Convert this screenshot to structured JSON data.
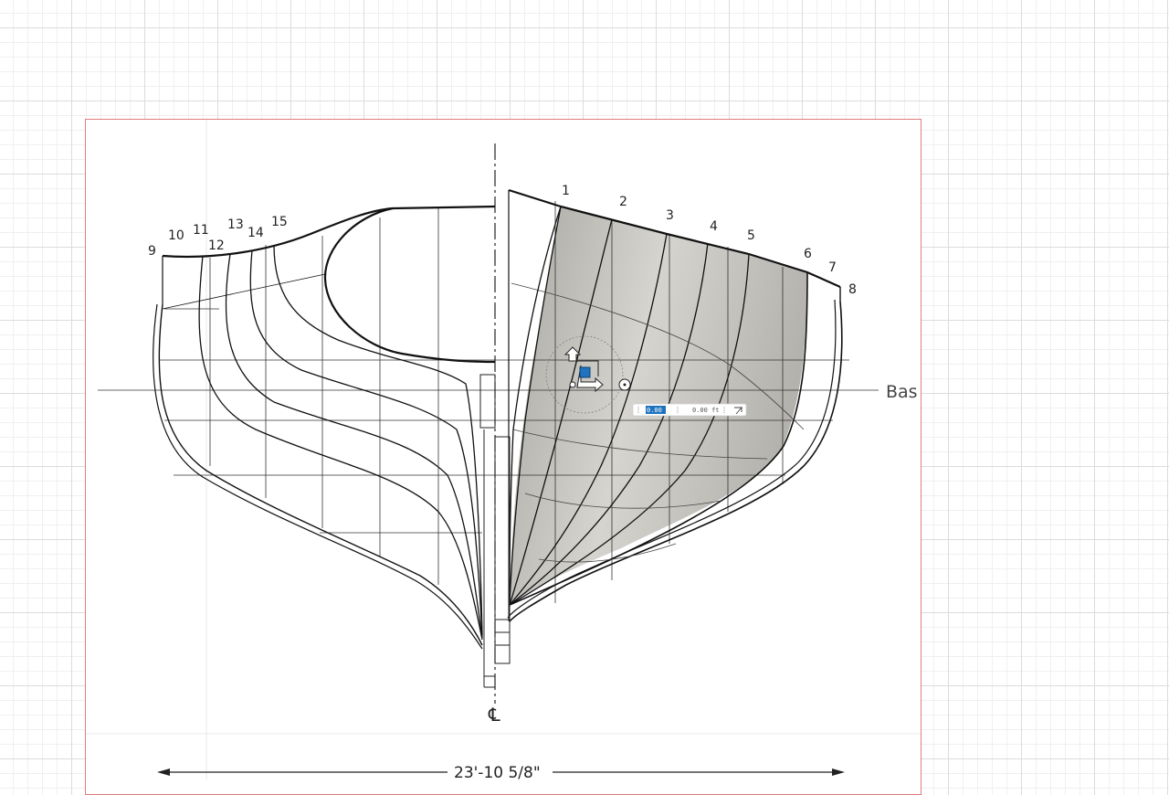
{
  "drawing": {
    "station_labels_right": [
      "1",
      "2",
      "3",
      "4",
      "5",
      "6",
      "7",
      "8"
    ],
    "station_labels_left": [
      "9",
      "10",
      "11",
      "12",
      "13",
      "14",
      "15"
    ],
    "baseline_label": "Bas",
    "centerline_label": "℄",
    "dimension_label": "23'-10 5/8\""
  },
  "manipulator": {
    "move_icon": "move-arrows-icon",
    "field_1_value": "0.00 ft",
    "field_2_value": "0.00 ft",
    "snap_icon": "snap-icon"
  },
  "colors": {
    "sheet_border": "#e07b7b",
    "surface_fill": "#c9c7c2",
    "selection": "#1e73be"
  }
}
